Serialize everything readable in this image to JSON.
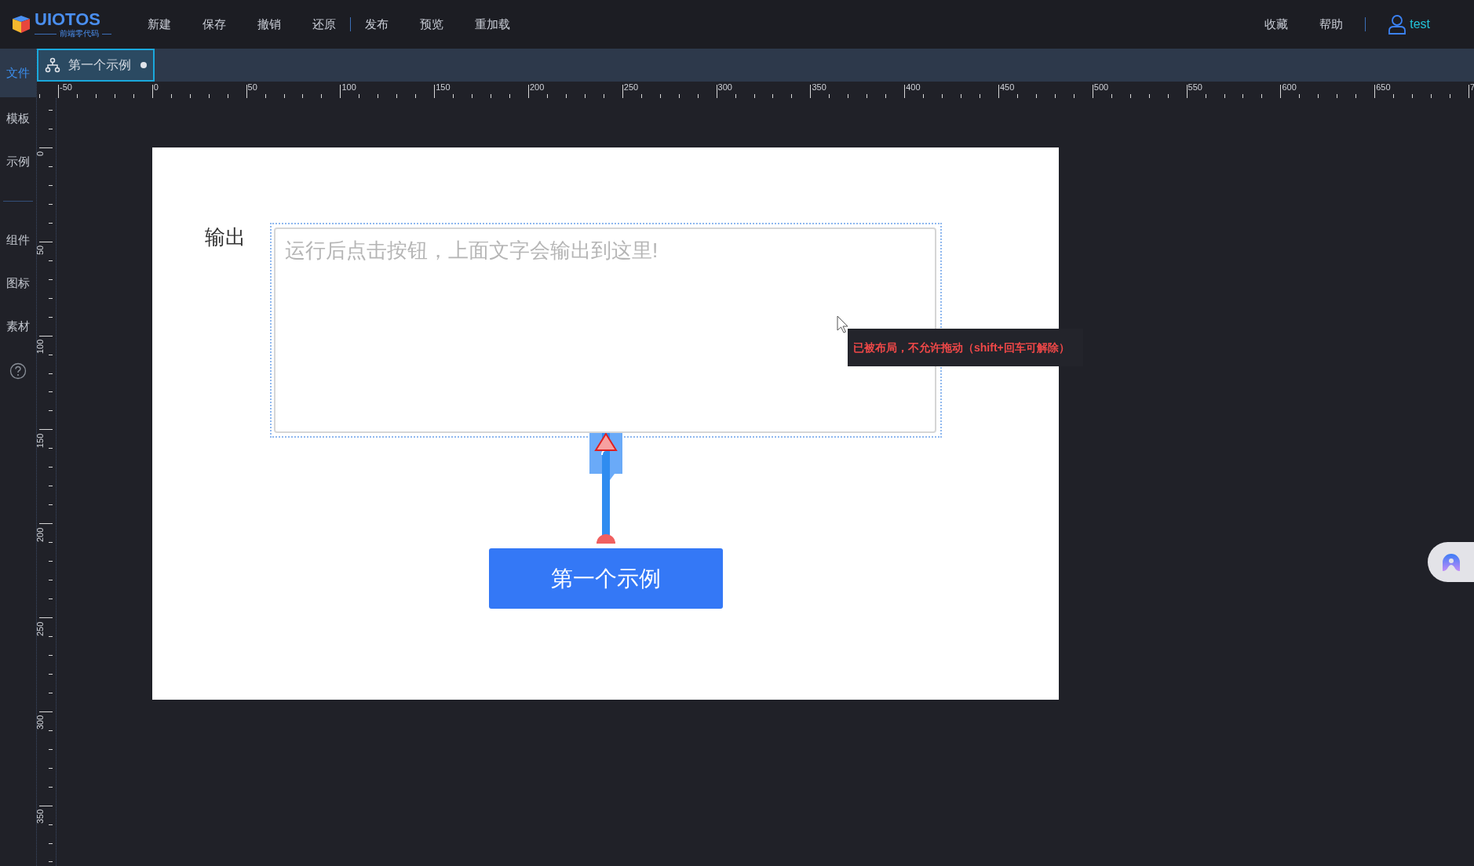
{
  "header": {
    "logo": {
      "name": "UIOTOS",
      "subtitle": "前端零代码"
    },
    "menu_groups": [
      [
        "新建",
        "保存",
        "撤销",
        "还原"
      ],
      [
        "发布",
        "预览",
        "重加载"
      ]
    ],
    "right_menu": [
      "收藏",
      "帮助"
    ],
    "user": "test"
  },
  "sidebar": {
    "groups": [
      [
        {
          "label": "文件",
          "selected": true
        },
        {
          "label": "模板",
          "selected": false
        },
        {
          "label": "示例",
          "selected": false
        }
      ],
      [
        {
          "label": "组件",
          "selected": false
        },
        {
          "label": "图标",
          "selected": false
        },
        {
          "label": "素材",
          "selected": false
        }
      ]
    ]
  },
  "tabs": [
    {
      "label": "第一个示例",
      "selected": true,
      "modified": true
    }
  ],
  "ruler": {
    "x_labels": [
      "-50",
      "0",
      "50",
      "100",
      "150",
      "200",
      "250",
      "300",
      "350",
      "400",
      "450",
      "500",
      "550",
      "600",
      "650",
      "7"
    ],
    "y_labels": [
      "0",
      "50",
      "100",
      "150",
      "200",
      "250",
      "300",
      "350"
    ]
  },
  "canvas": {
    "output_label": "输出",
    "output_box": {
      "placeholder": "运行后点击按钮，上面文字会输出到这里!"
    },
    "button": "第一个示例",
    "tooltip": "已被布局，不允许拖动（shift+回车可解除）"
  }
}
